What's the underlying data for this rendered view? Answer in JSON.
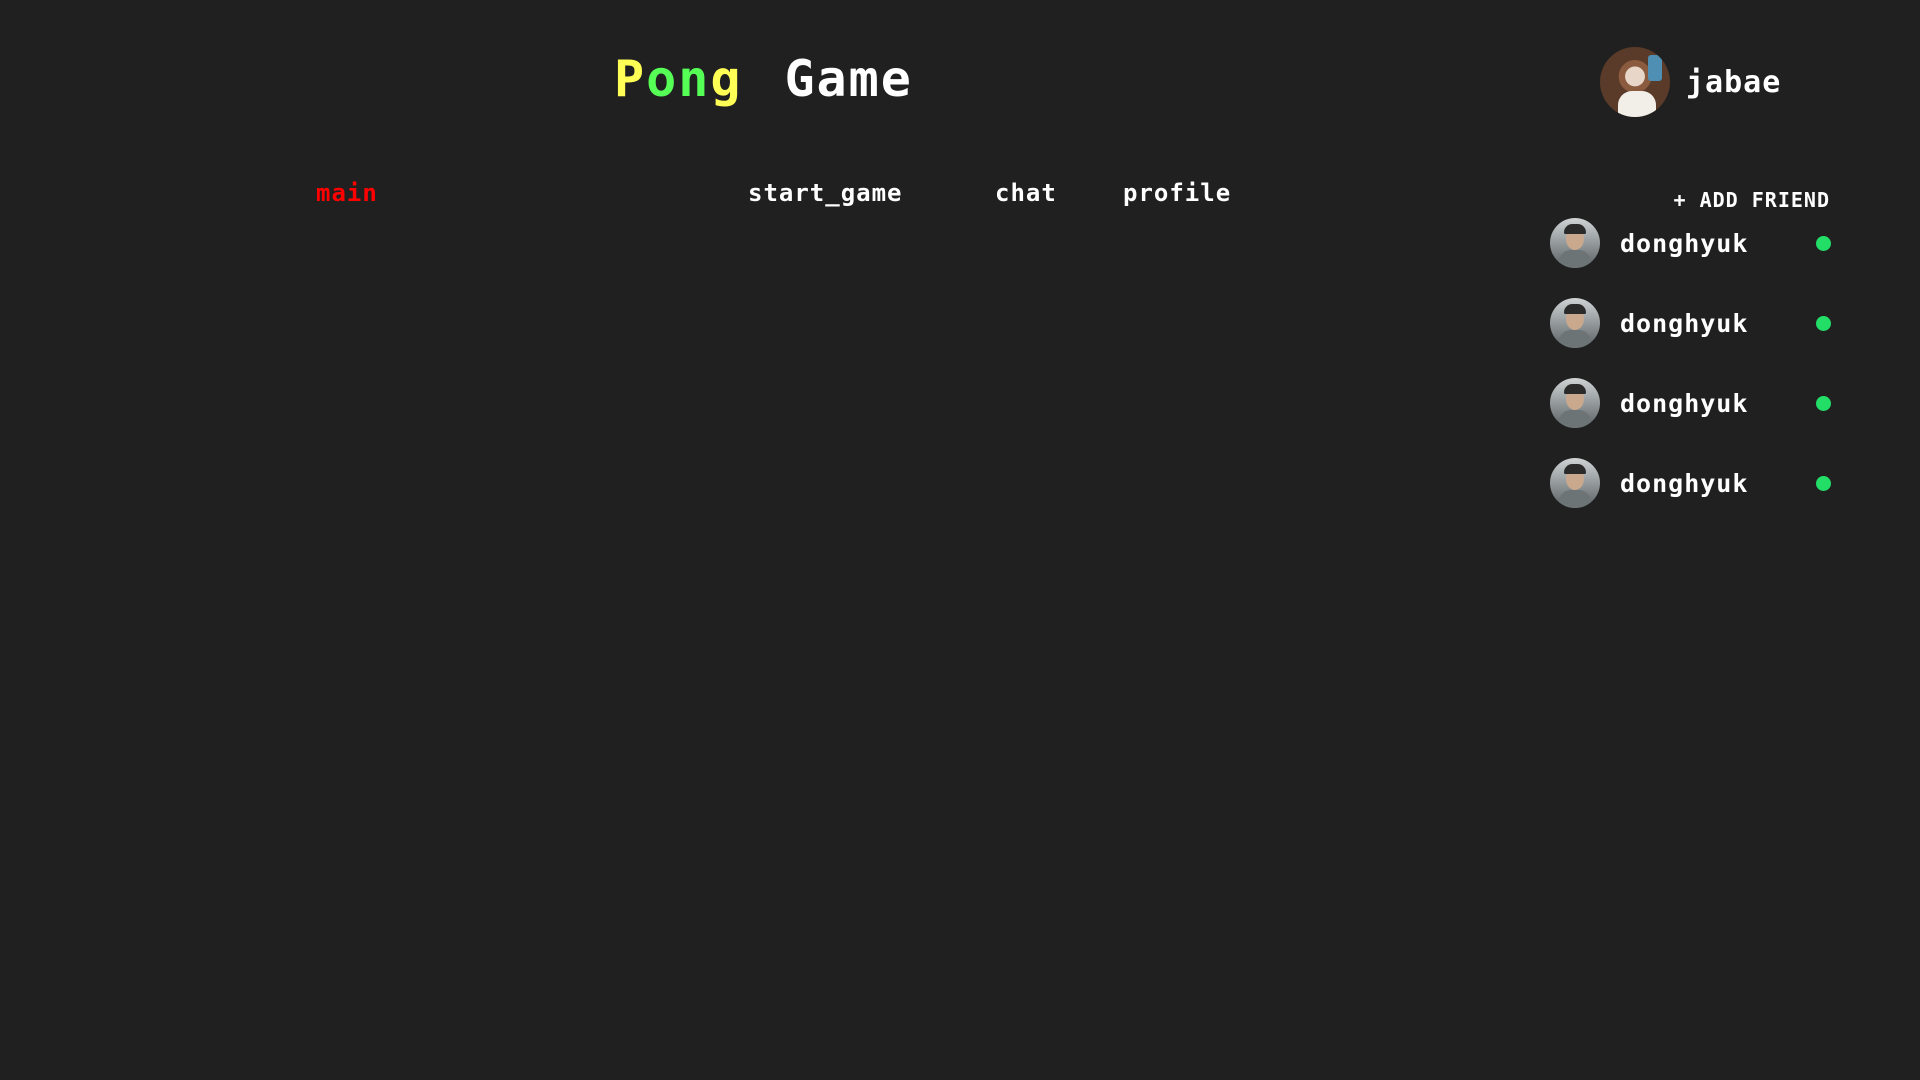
{
  "header": {
    "title_part1": "Po",
    "title_part2": "ng",
    "title_part3": "Game",
    "title_colors": {
      "yellow": "#ffff55",
      "green": "#55ff55",
      "white": "#ffffff"
    }
  },
  "current_user": {
    "username": "jabae",
    "avatar_icon": "user-avatar"
  },
  "nav": {
    "items": [
      {
        "label": "main",
        "active": true
      },
      {
        "label": "start_game",
        "active": false
      },
      {
        "label": "chat",
        "active": false
      },
      {
        "label": "profile",
        "active": false
      }
    ],
    "active_color": "#ff0000"
  },
  "friends": {
    "add_label": "+ ADD FRIEND",
    "status_color": "#22dd66",
    "list": [
      {
        "name": "donghyuk",
        "status": "online"
      },
      {
        "name": "donghyuk",
        "status": "online"
      },
      {
        "name": "donghyuk",
        "status": "online"
      },
      {
        "name": "donghyuk",
        "status": "online"
      }
    ]
  },
  "theme": {
    "background": "#202020"
  }
}
